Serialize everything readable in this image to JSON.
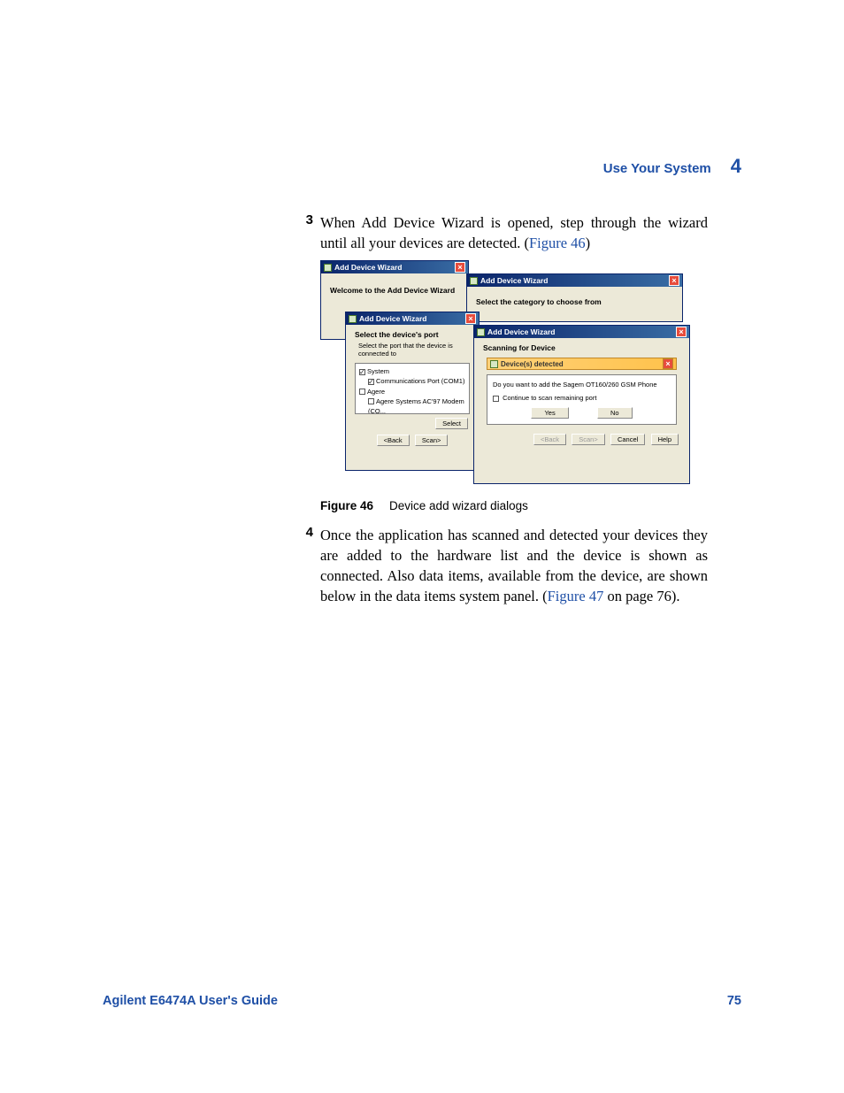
{
  "header": {
    "title": "Use Your System",
    "chapter": "4"
  },
  "steps": {
    "s3": {
      "num": "3",
      "text_a": "When Add Device Wizard is opened, step through the wizard until all your devices are detected. (",
      "xref": "Figure 46",
      "text_b": ")"
    },
    "s4": {
      "num": "4",
      "text_a": "Once the application has scanned and detected your devices they are added to the hardware list and the device is shown as connected. Also data items, available from the device, are shown below in the data items system panel. (",
      "xref": "Figure 47",
      "text_b": " on page 76)."
    }
  },
  "figure": {
    "label": "Figure 46",
    "caption": "Device add wizard dialogs",
    "dlg1": {
      "title": "Add Device Wizard",
      "heading": "Welcome to the Add Device Wizard"
    },
    "dlg2": {
      "title": "Add Device Wizard",
      "heading": "Select the category to choose from"
    },
    "dlg3": {
      "title": "Add Device Wizard",
      "heading": "Select the device's port",
      "sub": "Select the port that the device is connected to",
      "tree": {
        "n1": "System",
        "n2": "Communications Port (COM1)",
        "n3": "Agere",
        "n4": "Agere Systems AC'97 Modem (CO..."
      },
      "btn_select": "Select",
      "btn_back": "<Back",
      "btn_scan": "Scan>"
    },
    "dlg4": {
      "title": "Add Device Wizard",
      "heading": "Scanning for Device",
      "popup_title": "Device(s) detected",
      "popup_text": "Do you want to add the Sagem OT160/260 GSM Phone",
      "popup_chk": "Continue to scan remaining port",
      "btn_yes": "Yes",
      "btn_no": "No",
      "btn_back": "<Back",
      "btn_scan": "Scan>",
      "btn_cancel": "Cancel",
      "btn_help": "Help"
    }
  },
  "footer": {
    "guide": "Agilent E6474A User's Guide",
    "page": "75"
  }
}
